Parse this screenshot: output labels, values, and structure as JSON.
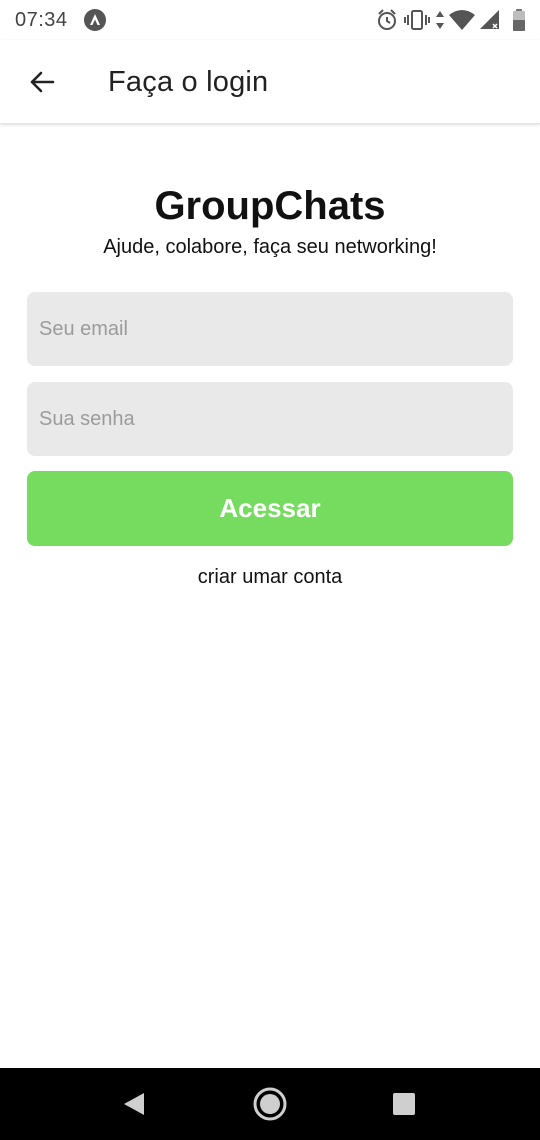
{
  "status_bar": {
    "time": "07:34",
    "icons": [
      "app-notification-icon",
      "alarm-icon",
      "vibrate-icon",
      "data-arrows-icon",
      "wifi-icon",
      "signal-icon",
      "battery-icon"
    ]
  },
  "app_bar": {
    "title": "Faça o login",
    "back_icon": "arrow-left-icon"
  },
  "login": {
    "brand_title": "GroupChats",
    "tagline": "Ajude, colabore, faça seu networking!",
    "email_placeholder": "Seu email",
    "email_value": "",
    "password_placeholder": "Sua senha",
    "password_value": "",
    "submit_label": "Acessar",
    "create_account_label": "criar umar conta"
  },
  "nav_bar": {
    "icons": [
      "nav-back-icon",
      "nav-home-icon",
      "nav-recents-icon"
    ]
  },
  "colors": {
    "accent": "#76dc5f",
    "field_background": "#e9e9e9",
    "nav_background": "#000000"
  }
}
